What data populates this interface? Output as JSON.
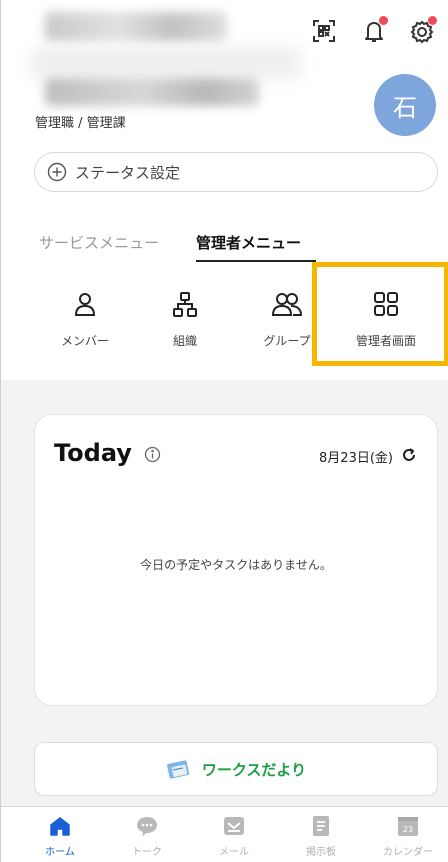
{
  "header": {
    "department": "管理職 / 管理課",
    "avatar_initial": "石",
    "icons": [
      "qr-code-icon",
      "bell-icon",
      "settings-icon"
    ],
    "notification_color": "#ef4a56"
  },
  "status": {
    "label": "ステータス設定"
  },
  "tabs": [
    {
      "label": "サービスメニュー",
      "active": false
    },
    {
      "label": "管理者メニュー",
      "active": true
    }
  ],
  "menu": {
    "items": [
      {
        "label": "メンバー",
        "icon": "person-icon"
      },
      {
        "label": "組織",
        "icon": "org-chart-icon"
      },
      {
        "label": "グループ",
        "icon": "group-icon"
      },
      {
        "label": "管理者画面",
        "icon": "grid-icon",
        "highlighted": true
      }
    ],
    "highlight_color": "#f5b800"
  },
  "today": {
    "title": "Today",
    "date": "8月23日(金)",
    "empty_message": "今日の予定やタスクはありません。"
  },
  "works": {
    "label": "ワークスだより",
    "color": "#1a9f45"
  },
  "bottom_nav": {
    "items": [
      {
        "label": "ホーム",
        "icon": "home-icon",
        "active": true
      },
      {
        "label": "トーク",
        "icon": "chat-icon",
        "active": false
      },
      {
        "label": "メール",
        "icon": "mail-icon",
        "active": false
      },
      {
        "label": "掲示板",
        "icon": "board-icon",
        "active": false
      },
      {
        "label": "カレンダー",
        "icon": "calendar-icon",
        "active": false,
        "badge": "23"
      }
    ],
    "active_color": "#1a5fd6"
  }
}
